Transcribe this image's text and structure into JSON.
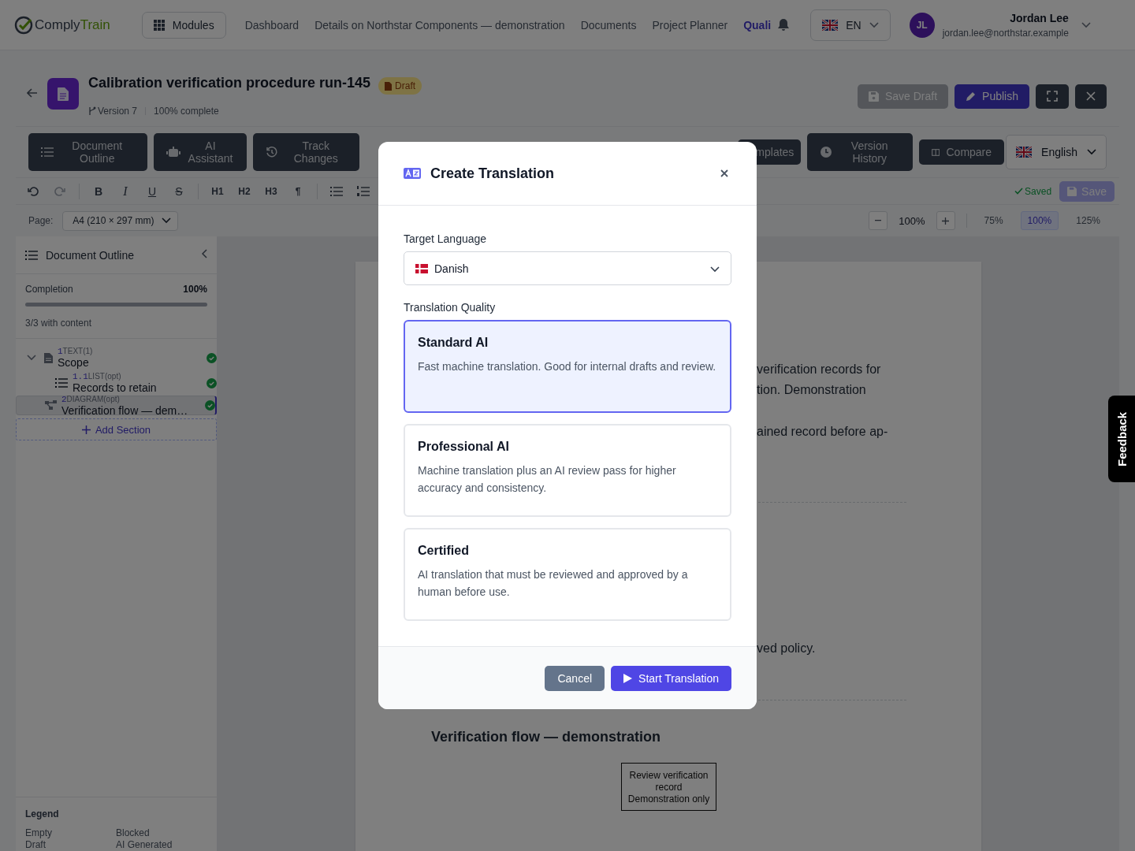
{
  "nav": {
    "logo": {
      "brand": "Comply",
      "accent": "Train"
    },
    "modules": "Modules",
    "links": [
      {
        "label": "Dashboard",
        "selected": false
      },
      {
        "label": "Details on Northstar Components — demonstration",
        "selected": false
      },
      {
        "label": "Documents",
        "selected": false
      },
      {
        "label": "Project Planner",
        "selected": false
      },
      {
        "label": "Quali",
        "selected": true
      }
    ],
    "language": "EN",
    "user": {
      "initials": "JL",
      "name": "Jordan Lee",
      "email": "jordan.lee@northstar.example"
    }
  },
  "document": {
    "title": "Calibration verification procedure run-145",
    "status": "Draft",
    "version": "Version 7",
    "progress": "100% complete",
    "actions": [
      {
        "kind": "secondary",
        "label": "Save Draft",
        "disabled": true
      },
      {
        "kind": "primary",
        "label": "Publish",
        "disabled": false
      },
      {
        "kind": "fullscreen",
        "disabled": false
      },
      {
        "kind": "close",
        "disabled": false
      }
    ]
  },
  "panels": [
    {
      "label": "Document Outline"
    },
    {
      "label": "AI Assistant"
    },
    {
      "label": "Track Changes"
    },
    {
      "label": "mplates"
    },
    {
      "label": "Version History"
    },
    {
      "label": "Compare"
    }
  ],
  "content_language": "English",
  "toolbar": {
    "history": [
      {
        "kind": "undo",
        "disabled": false
      },
      {
        "kind": "redo",
        "disabled": true
      }
    ],
    "styles": [
      "B",
      "I",
      "U",
      "S"
    ],
    "headings": [
      "H1",
      "H2",
      "H3",
      "¶"
    ],
    "saved": "Saved",
    "save": {
      "label": "Save",
      "disabled": true
    }
  },
  "page_bar": {
    "label": "Page:",
    "size": "A4 (210 × 297 mm)",
    "zoom": "100%",
    "presets": [
      {
        "label": "75%",
        "selected": false
      },
      {
        "label": "100%",
        "selected": true
      },
      {
        "label": "125%",
        "selected": false
      }
    ]
  },
  "outline": {
    "title": "Document Outline",
    "completion_label": "Completion",
    "completion": "100%",
    "level": 1,
    "content_count": "3/3 with content",
    "sections": [
      {
        "number": "1",
        "type": "TEXT(1)",
        "title": "Scope",
        "kind": "text",
        "done": true,
        "selected": false,
        "expanded": true,
        "children": [
          {
            "number": "1.1",
            "type": "LIST(opt)",
            "title": "Records to retain",
            "kind": "list",
            "done": true,
            "selected": false
          }
        ]
      },
      {
        "number": "2",
        "type": "DIAGRAM(opt)",
        "title": "Verification flow — dem…",
        "kind": "diagram",
        "done": true,
        "selected": true
      }
    ],
    "add": "Add Section",
    "legend_title": "Legend",
    "legend": [
      "Empty",
      "Blocked",
      "Draft",
      "AI Generated"
    ]
  },
  "page": {
    "paragraph_1": [
      "verification records for",
      "tion. Demonstration"
    ],
    "paragraph_2": [
      "ained record before ap-"
    ],
    "paragraph_3": [
      "ved policy."
    ],
    "heading": "Verification flow — demonstration",
    "node": [
      "Review verification",
      "record",
      "Demonstration only"
    ]
  },
  "feedback": "Feedback",
  "dialog": {
    "title": "Create Translation",
    "language_label": "Target Language",
    "language": "Danish",
    "quality_label": "Translation Quality",
    "options": [
      {
        "title": "Standard AI",
        "description": "Fast machine translation. Good for internal drafts and review.",
        "selected": true
      },
      {
        "title": "Professional AI",
        "description": "Machine translation plus an AI review pass for higher accuracy and consistency.",
        "selected": false
      },
      {
        "title": "Certified",
        "description": "AI translation that must be reviewed and approved by a human before use.",
        "selected": false
      }
    ],
    "cancel": "Cancel",
    "confirm": "Start Translation"
  }
}
